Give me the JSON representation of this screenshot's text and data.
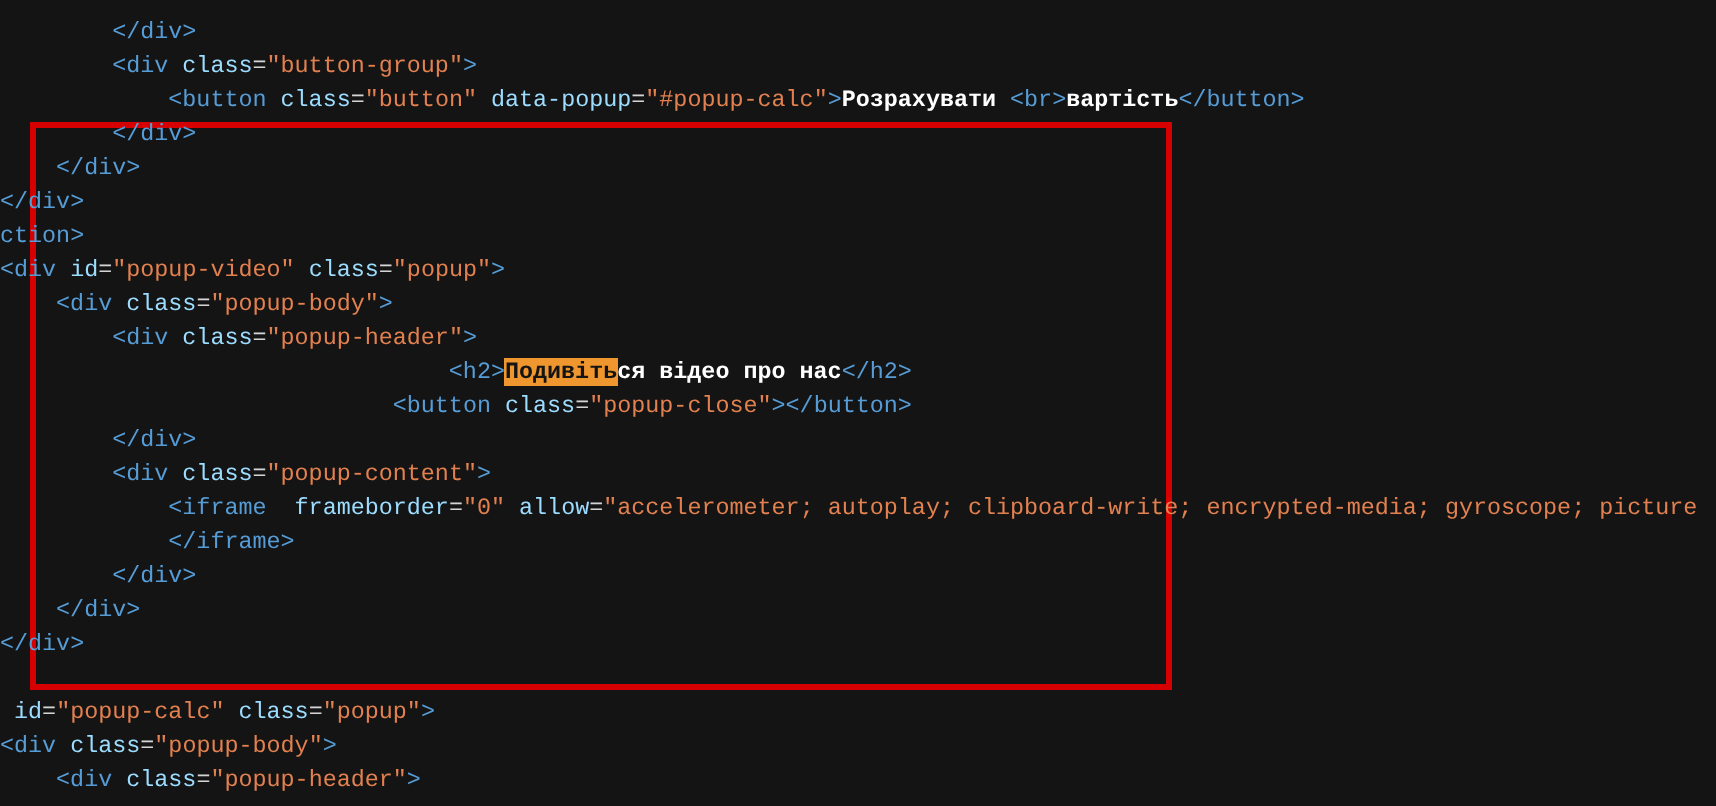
{
  "code_lines": [
    {
      "kind": "group",
      "children": [
        {
          "kind": "group",
          "children": [
            {
              "kind": "line",
              "tokens": [
                {
                  "kind": "tag",
                  "text": "</div>"
                }
              ]
            },
            {
              "kind": "line",
              "tokens": [
                {
                  "kind": "tag",
                  "text": "<div"
                },
                {
                  "kind": "attr",
                  "text": " class"
                },
                {
                  "kind": "punct",
                  "text": "="
                },
                {
                  "kind": "string",
                  "text": "\"button-group\""
                },
                {
                  "kind": "tag",
                  "text": ">"
                }
              ]
            },
            {
              "kind": "group",
              "children": [
                {
                  "kind": "line",
                  "tokens": [
                    {
                      "kind": "tag",
                      "text": "<button"
                    },
                    {
                      "kind": "attr",
                      "text": " class"
                    },
                    {
                      "kind": "punct",
                      "text": "="
                    },
                    {
                      "kind": "string",
                      "text": "\"button\""
                    },
                    {
                      "kind": "attr",
                      "text": " data-popup"
                    },
                    {
                      "kind": "punct",
                      "text": "="
                    },
                    {
                      "kind": "string",
                      "text": "\"#popup-calc\""
                    },
                    {
                      "kind": "tag",
                      "text": ">"
                    },
                    {
                      "kind": "text",
                      "text": "Розрахувати "
                    },
                    {
                      "kind": "tag",
                      "text": "<br>"
                    },
                    {
                      "kind": "text",
                      "text": "вартість"
                    },
                    {
                      "kind": "tag",
                      "text": "</button>"
                    }
                  ]
                }
              ]
            },
            {
              "kind": "line",
              "tokens": [
                {
                  "kind": "tag",
                  "text": "</div>"
                }
              ]
            }
          ]
        },
        {
          "kind": "line",
          "tokens": [
            {
              "kind": "tag",
              "text": "</div>"
            }
          ]
        }
      ]
    },
    {
      "kind": "line",
      "tokens": [
        {
          "kind": "tag",
          "text": "</div>"
        }
      ]
    },
    {
      "kind": "line",
      "tokens": [
        {
          "kind": "tag",
          "text": "ction>"
        }
      ]
    },
    {
      "kind": "line",
      "tokens": [
        {
          "kind": "tag",
          "text": "<div"
        },
        {
          "kind": "attr",
          "text": " id"
        },
        {
          "kind": "punct",
          "text": "="
        },
        {
          "kind": "string",
          "text": "\"popup-video\""
        },
        {
          "kind": "attr",
          "text": " class"
        },
        {
          "kind": "punct",
          "text": "="
        },
        {
          "kind": "string",
          "text": "\"popup\""
        },
        {
          "kind": "tag",
          "text": ">"
        }
      ]
    },
    {
      "kind": "group",
      "children": [
        {
          "kind": "line",
          "tokens": [
            {
              "kind": "tag",
              "text": "<div"
            },
            {
              "kind": "attr",
              "text": " class"
            },
            {
              "kind": "punct",
              "text": "="
            },
            {
              "kind": "string",
              "text": "\"popup-body\""
            },
            {
              "kind": "tag",
              "text": ">"
            }
          ]
        },
        {
          "kind": "group",
          "children": [
            {
              "kind": "line",
              "tokens": [
                {
                  "kind": "tag",
                  "text": "<div"
                },
                {
                  "kind": "attr",
                  "text": " class"
                },
                {
                  "kind": "punct",
                  "text": "="
                },
                {
                  "kind": "string",
                  "text": "\"popup-header\""
                },
                {
                  "kind": "tag",
                  "text": ">"
                }
              ]
            },
            {
              "kind": "group",
              "children": [
                {
                  "kind": "group",
                  "children": [
                    {
                      "kind": "group",
                      "children": [
                        {
                          "kind": "group",
                          "children": [
                            {
                              "kind": "group",
                              "children": [
                                {
                                  "kind": "group",
                                  "children": [
                                    {
                                      "kind": "line",
                                      "tokens": [
                                        {
                                          "kind": "tag",
                                          "text": "<h2>"
                                        },
                                        {
                                          "kind": "highlight",
                                          "text": "Подивіть"
                                        },
                                        {
                                          "kind": "text",
                                          "text": "ся відео про нас"
                                        },
                                        {
                                          "kind": "tag",
                                          "text": "</h2>"
                                        }
                                      ]
                                    }
                                  ]
                                },
                                {
                                  "kind": "line",
                                  "tokens": [
                                    {
                                      "kind": "tag",
                                      "text": "<button"
                                    },
                                    {
                                      "kind": "attr",
                                      "text": " class"
                                    },
                                    {
                                      "kind": "punct",
                                      "text": "="
                                    },
                                    {
                                      "kind": "string",
                                      "text": "\"popup-close\""
                                    },
                                    {
                                      "kind": "tag",
                                      "text": "></button>"
                                    }
                                  ]
                                }
                              ]
                            }
                          ]
                        }
                      ]
                    }
                  ]
                }
              ]
            },
            {
              "kind": "line",
              "tokens": [
                {
                  "kind": "tag",
                  "text": "</div>"
                }
              ]
            },
            {
              "kind": "line",
              "tokens": [
                {
                  "kind": "tag",
                  "text": "<div"
                },
                {
                  "kind": "attr",
                  "text": " class"
                },
                {
                  "kind": "punct",
                  "text": "="
                },
                {
                  "kind": "string",
                  "text": "\"popup-content\""
                },
                {
                  "kind": "tag",
                  "text": ">"
                }
              ]
            },
            {
              "kind": "group",
              "children": [
                {
                  "kind": "line",
                  "tokens": [
                    {
                      "kind": "tag",
                      "text": "<iframe"
                    },
                    {
                      "kind": "attr",
                      "text": "  frameborder"
                    },
                    {
                      "kind": "punct",
                      "text": "="
                    },
                    {
                      "kind": "string",
                      "text": "\"0\""
                    },
                    {
                      "kind": "attr",
                      "text": " allow"
                    },
                    {
                      "kind": "punct",
                      "text": "="
                    },
                    {
                      "kind": "string",
                      "text": "\"accelerometer; autoplay; clipboard-write; encrypted-media; gyroscope; picture"
                    }
                  ]
                },
                {
                  "kind": "line",
                  "tokens": [
                    {
                      "kind": "tag",
                      "text": "</iframe>"
                    }
                  ]
                }
              ]
            },
            {
              "kind": "line",
              "tokens": [
                {
                  "kind": "tag",
                  "text": "</div>"
                }
              ]
            }
          ]
        },
        {
          "kind": "line",
          "tokens": [
            {
              "kind": "tag",
              "text": "</div>"
            }
          ]
        }
      ]
    },
    {
      "kind": "line",
      "tokens": [
        {
          "kind": "tag",
          "text": "</div>"
        }
      ]
    },
    {
      "kind": "blank"
    },
    {
      "kind": "line",
      "tokens": [
        {
          "kind": "attr",
          "text": " id"
        },
        {
          "kind": "punct",
          "text": "="
        },
        {
          "kind": "string",
          "text": "\"popup-calc\""
        },
        {
          "kind": "attr",
          "text": " class"
        },
        {
          "kind": "punct",
          "text": "="
        },
        {
          "kind": "string",
          "text": "\"popup\""
        },
        {
          "kind": "tag",
          "text": ">"
        }
      ]
    },
    {
      "kind": "line",
      "tokens": [
        {
          "kind": "tag",
          "text": "<div"
        },
        {
          "kind": "attr",
          "text": " class"
        },
        {
          "kind": "punct",
          "text": "="
        },
        {
          "kind": "string",
          "text": "\"popup-body\""
        },
        {
          "kind": "tag",
          "text": ">"
        }
      ]
    },
    {
      "kind": "group",
      "children": [
        {
          "kind": "line",
          "tokens": [
            {
              "kind": "tag",
              "text": "<div"
            },
            {
              "kind": "attr",
              "text": " class"
            },
            {
              "kind": "punct",
              "text": "="
            },
            {
              "kind": "string",
              "text": "\"popup-header\""
            },
            {
              "kind": "tag",
              "text": ">"
            }
          ]
        }
      ]
    }
  ],
  "annotations": [
    {
      "kind": "rectangle"
    }
  ]
}
